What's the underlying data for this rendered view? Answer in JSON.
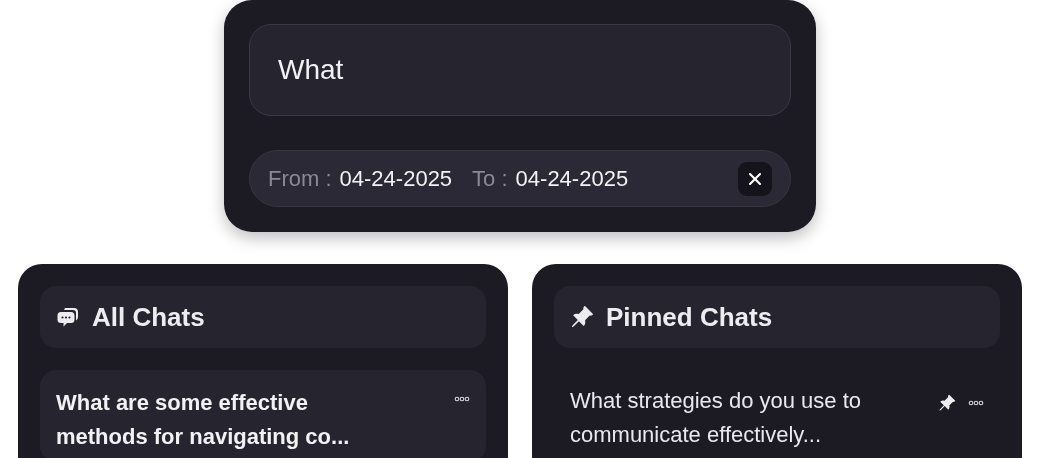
{
  "search": {
    "value": "What"
  },
  "date_filter": {
    "from_label": "From :",
    "from_value": "04-24-2025",
    "to_label": "To :",
    "to_value": "04-24-2025"
  },
  "panels": [
    {
      "kind": "all",
      "title": "All Chats",
      "chats": [
        {
          "title": "What are some effective methods for navigating co...",
          "selected": true,
          "pinned": false
        }
      ]
    },
    {
      "kind": "pinned",
      "title": "Pinned Chats",
      "chats": [
        {
          "title": "What strategies do you use to communicate effectively...",
          "selected": false,
          "pinned": true
        }
      ]
    }
  ]
}
